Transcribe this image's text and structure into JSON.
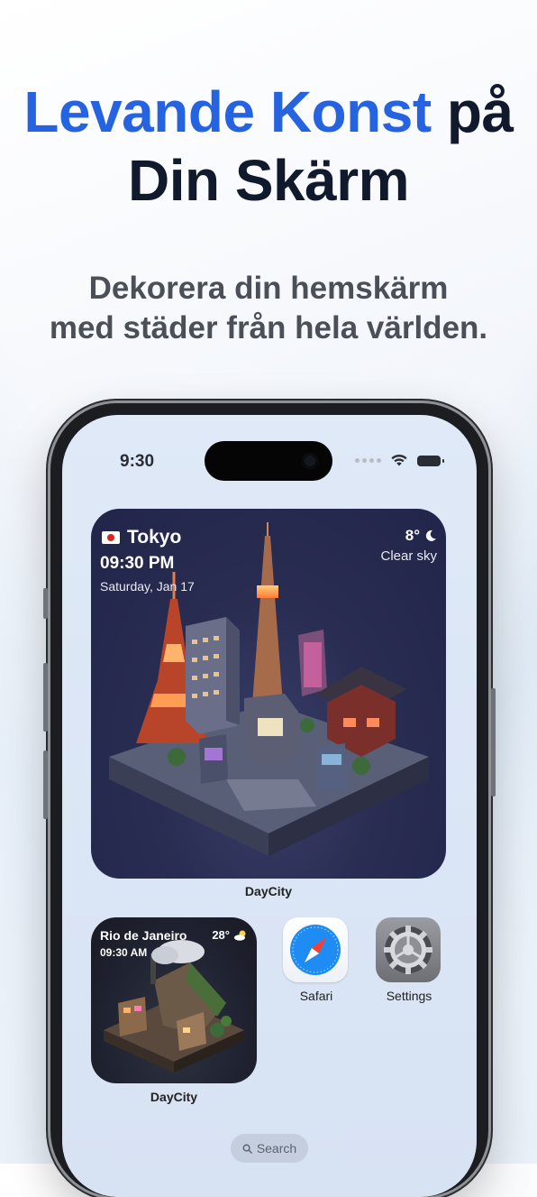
{
  "headline": {
    "accent": "Levande Konst",
    "line1_rest": "på",
    "line2": "Din Skärm",
    "accent_color": "#2563e0",
    "text_color": "#111a2c"
  },
  "subtitle": {
    "line1": "Dekorera din hemskärm",
    "line2": "med städer från hela världen."
  },
  "status_bar": {
    "time": "9:30",
    "icons": [
      "signal-dots-icon",
      "wifi-icon",
      "battery-icon"
    ]
  },
  "widget_large": {
    "flag": "japan-flag-icon",
    "city": "Tokyo",
    "time": "09:30 PM",
    "date": "Saturday, Jan 17",
    "temperature": "8°",
    "weather_icon": "moon-icon",
    "condition": "Clear sky",
    "app_label": "DayCity"
  },
  "widget_small": {
    "city": "Rio de Janeiro",
    "time": "09:30 AM",
    "temperature": "28°",
    "weather_icon": "partly-cloudy-icon",
    "app_label": "DayCity"
  },
  "apps": [
    {
      "label": "Safari",
      "icon": "safari-compass-icon"
    },
    {
      "label": "Settings",
      "icon": "settings-gear-icon"
    }
  ],
  "search": {
    "label": "Search",
    "icon": "search-icon"
  }
}
